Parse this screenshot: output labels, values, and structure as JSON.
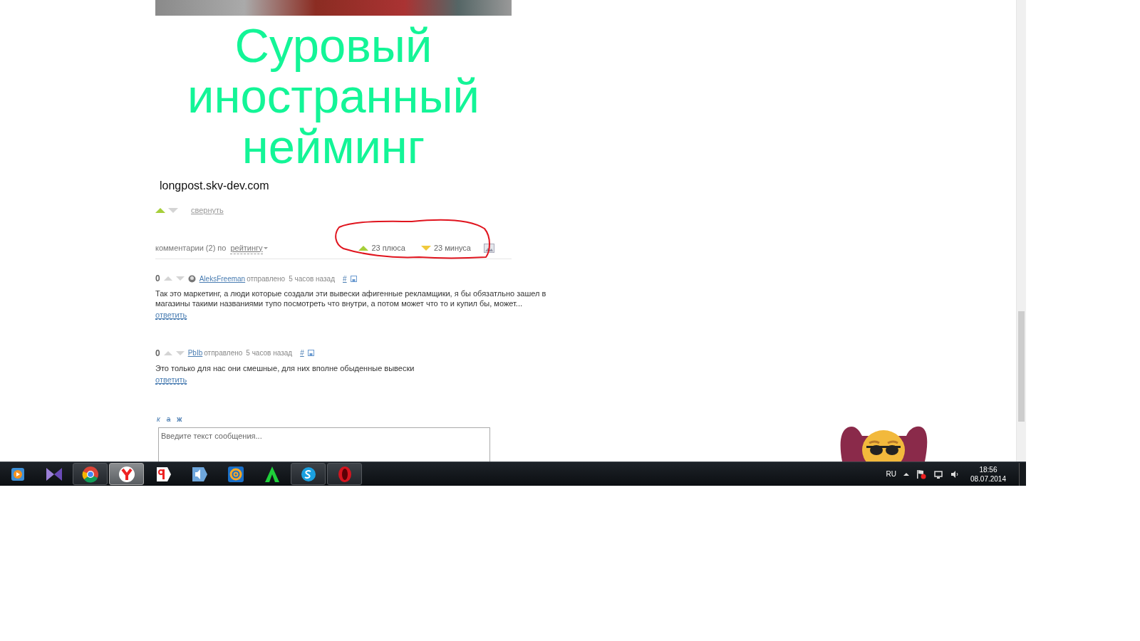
{
  "post": {
    "title": "Суровый иностранный нейминг",
    "source": "longpost.skv-dev.com",
    "collapse_link": "свернуть"
  },
  "comments_header": {
    "label": "комментарии (2) по",
    "sort": "рейтингу",
    "pluses": "23 плюса",
    "minuses": "23 минуса"
  },
  "comments": [
    {
      "score": "0",
      "author": "AleksFreeman",
      "has_avatar": true,
      "sent": "отправлено",
      "time": "5 часов назад",
      "anchor": "#",
      "text": "Так это маркетинг, а люди которые создали эти вывески афигенные рекламщики, я бы обязатльно зашел в магазины такими названиями тупо посмотреть что внутри, а потом может что то и купил бы, может...",
      "reply": "ответить"
    },
    {
      "score": "0",
      "author": "PbIb",
      "has_avatar": false,
      "sent": "отправлено",
      "time": "5 часов назад",
      "anchor": "#",
      "text": "Это только для нас они смешные, для них вполне обыденные вывески",
      "reply": "ответить"
    }
  ],
  "editor": {
    "format_buttons": [
      {
        "kind": "italic",
        "label": "к"
      },
      {
        "kind": "strike",
        "label": "а"
      },
      {
        "kind": "bold",
        "label": "ж"
      }
    ],
    "placeholder": "Введите текст сообщения..."
  },
  "taskbar": {
    "apps": [
      {
        "kind": "media",
        "running": false,
        "selected": false
      },
      {
        "kind": "bowtie",
        "running": false,
        "selected": false
      },
      {
        "kind": "chrome",
        "running": true,
        "selected": false
      },
      {
        "kind": "yandex-browser",
        "running": true,
        "selected": true
      },
      {
        "kind": "yandex",
        "running": false,
        "selected": false
      },
      {
        "kind": "speaker",
        "running": false,
        "selected": false
      },
      {
        "kind": "at",
        "running": false,
        "selected": false
      },
      {
        "kind": "letter-a",
        "running": false,
        "selected": false
      },
      {
        "kind": "skype",
        "running": true,
        "selected": false
      },
      {
        "kind": "opera",
        "running": true,
        "selected": false
      }
    ],
    "language": "RU",
    "time": "18:56",
    "date": "08.07.2014"
  }
}
